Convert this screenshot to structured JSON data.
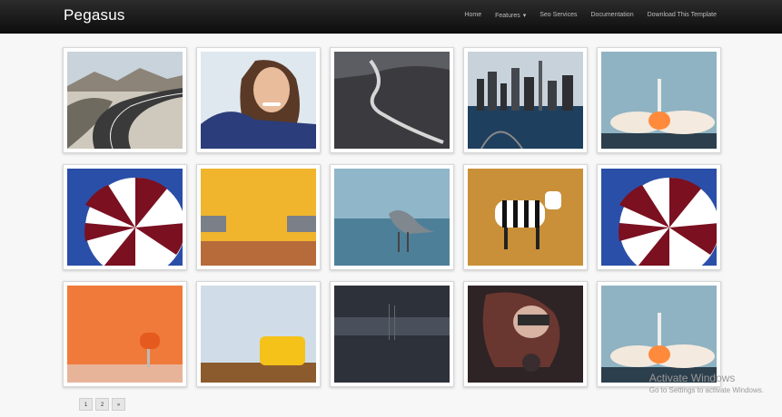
{
  "header": {
    "brand": "Pegasus",
    "nav": [
      {
        "label": "Home"
      },
      {
        "label": "Features"
      },
      {
        "label": "Seo Services"
      },
      {
        "label": "Documentation"
      },
      {
        "label": "Download This Template"
      }
    ]
  },
  "gallery": {
    "items": [
      {
        "subject": "road"
      },
      {
        "subject": "woman"
      },
      {
        "subject": "winding-road"
      },
      {
        "subject": "city"
      },
      {
        "subject": "rocket"
      },
      {
        "subject": "umbrella"
      },
      {
        "subject": "chairs-yellow"
      },
      {
        "subject": "heron"
      },
      {
        "subject": "zebra"
      },
      {
        "subject": "umbrella"
      },
      {
        "subject": "chair-orange"
      },
      {
        "subject": "armchair-yellow"
      },
      {
        "subject": "misty-water"
      },
      {
        "subject": "woman-dark"
      },
      {
        "subject": "rocket"
      }
    ]
  },
  "pagination": {
    "pages": [
      "1",
      "2",
      "»"
    ]
  },
  "watermark": {
    "title": "Activate Windows",
    "subtitle": "Go to Settings to activate Windows."
  }
}
